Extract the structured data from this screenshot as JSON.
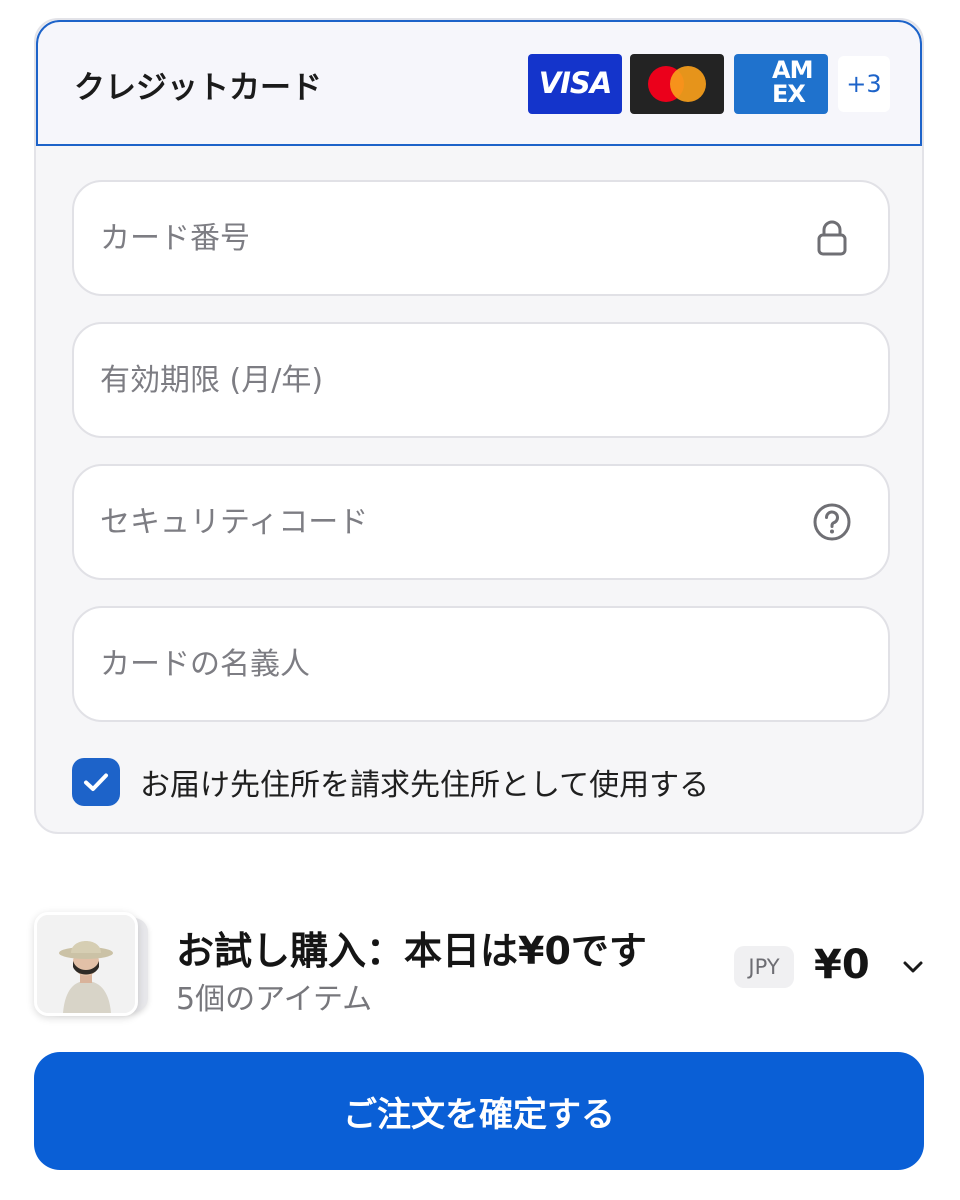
{
  "payment": {
    "title": "クレジットカード",
    "brands": [
      {
        "name": "visa",
        "label": "VISA"
      },
      {
        "name": "mastercard"
      },
      {
        "name": "amex",
        "label_line1": "AM",
        "label_line2": "EX"
      }
    ],
    "more_brands": "+3",
    "fields": {
      "card_number": {
        "placeholder": "カード番号",
        "icon": "lock-icon"
      },
      "expiry": {
        "placeholder": "有効期限 (月/年)"
      },
      "security_code": {
        "placeholder": "セキュリティコード",
        "icon": "help-circle-icon"
      },
      "cardholder": {
        "placeholder": "カードの名義人"
      }
    },
    "billing_same_as_shipping": {
      "checked": true,
      "label": "お届け先住所を請求先住所として使用する"
    }
  },
  "summary": {
    "title": "お試し購入：本日は¥0です",
    "item_count": "5個のアイテム",
    "currency": "JPY",
    "price": "¥0"
  },
  "confirm_button": {
    "label": "ご注文を確定する"
  },
  "colors": {
    "accent": "#0a5fd6",
    "header_border": "#1d63c9",
    "panel_bg": "#f6f6f8",
    "visa": "#1434cb",
    "mastercard_bg": "#232323",
    "amex": "#1f72cd"
  }
}
